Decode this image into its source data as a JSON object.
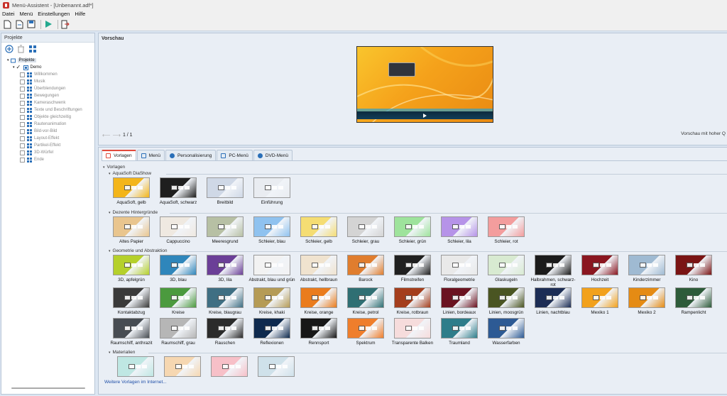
{
  "window": {
    "title": "Menü-Assistent - [Unbenannt.adf*]"
  },
  "menu": [
    "Datei",
    "Menü",
    "Einstellungen",
    "Hilfe"
  ],
  "toolbar": {
    "icons": [
      "new-document-icon",
      "open-icon",
      "save-icon",
      "play-icon",
      "exit-icon"
    ]
  },
  "projects": {
    "header": "Projekte",
    "root_label": "Projekte",
    "project_label": "Demo",
    "items": [
      "Willkommen",
      "Musik",
      "Überblendungen",
      "Bewegungen",
      "Kameraschwenk",
      "Texte und Beschriftungen",
      "Objekte gleichzeitig",
      "Rautenanimation",
      "Bild-vor-Bild",
      "Layout-Effekt",
      "Partikel-Effekt",
      "3D-Würfel",
      "Ende"
    ]
  },
  "preview": {
    "label": "Vorschau",
    "page": "1 / 1",
    "hq_label": "Vorschau mit hoher Q"
  },
  "tabs": [
    "Vorlagen",
    "Menü",
    "Personalisierung",
    "PC-Menü",
    "DVD-Menü"
  ],
  "gallery": {
    "root": "Vorlagen",
    "groups": [
      {
        "name": "AquaSoft DiaShow",
        "items": [
          {
            "label": "AquaSoft, gelb",
            "color": "#f3b51a",
            "dark": false
          },
          {
            "label": "AquaSoft, schwarz",
            "color": "#1e1e1e",
            "dark": true
          },
          {
            "label": "Breitbild",
            "color": "#cfd8e6",
            "dark": false
          },
          {
            "label": "Einführung",
            "color": "#e9ecf1",
            "dark": false
          }
        ]
      },
      {
        "name": "Dezente Hintergründe",
        "items": [
          {
            "label": "Altes Papier",
            "color": "#e9c58e"
          },
          {
            "label": "Cappuccino",
            "color": "#efe9e1"
          },
          {
            "label": "Meeresgrund",
            "color": "#b7c0a4"
          },
          {
            "label": "Schleier, blau",
            "color": "#8fc2ef"
          },
          {
            "label": "Schleier, gelb",
            "color": "#f5dd73"
          },
          {
            "label": "Schleier, grau",
            "color": "#d4d4d4"
          },
          {
            "label": "Schleier, grün",
            "color": "#9ee39c"
          },
          {
            "label": "Schleier, lila",
            "color": "#b693e8"
          },
          {
            "label": "Schleier, rot",
            "color": "#f39d9d"
          }
        ]
      },
      {
        "name": "Geometrie und Abstraktion",
        "rows": [
          [
            {
              "label": "3D, apfelgrün",
              "color": "#b5d02b"
            },
            {
              "label": "3D, blau",
              "color": "#2f86bb"
            },
            {
              "label": "3D, lila",
              "color": "#6b3f97"
            },
            {
              "label": "Abstrakt, blau und grün",
              "color": "#f2f2f2"
            },
            {
              "label": "Abstrakt, hellbraun",
              "color": "#f0e3cf"
            },
            {
              "label": "Barock",
              "color": "#e07d2e"
            },
            {
              "label": "Filmstreifen",
              "color": "#202020"
            },
            {
              "label": "Floralgeometrie",
              "color": "#e9e9e9"
            },
            {
              "label": "Glaskugeln",
              "color": "#d8ead1"
            },
            {
              "label": "Halbrahmen, schwarz-rot",
              "color": "#1b1b1b"
            },
            {
              "label": "Hochzeit",
              "color": "#8a1620"
            },
            {
              "label": "Kinderzimmer",
              "color": "#9fbad2"
            },
            {
              "label": "Kino",
              "color": "#7a1414"
            }
          ],
          [
            {
              "label": "Kontaktabzug",
              "color": "#3a3a3a"
            },
            {
              "label": "Kreise",
              "color": "#4b9a3e"
            },
            {
              "label": "Kreise, blaugrau",
              "color": "#3f6f83"
            },
            {
              "label": "Kreise, khaki",
              "color": "#b59b56"
            },
            {
              "label": "Kreise, orange",
              "color": "#ea7c1d"
            },
            {
              "label": "Kreise, petrol",
              "color": "#2f6f73"
            },
            {
              "label": "Kreise, rotbraun",
              "color": "#a43e1d"
            },
            {
              "label": "Linien, bordeaux",
              "color": "#6a1220"
            },
            {
              "label": "Linien, moosgrün",
              "color": "#4a5522"
            },
            {
              "label": "Linien, nachtblau",
              "color": "#1c2d55"
            },
            {
              "label": "Mexiko 1",
              "color": "#f2a11c"
            },
            {
              "label": "Mexiko 2",
              "color": "#e58b14"
            },
            {
              "label": "Rampenlicht",
              "color": "#2d5b3a"
            }
          ],
          [
            {
              "label": "Raumschiff, anthrazit",
              "color": "#474c52"
            },
            {
              "label": "Raumschiff, grau",
              "color": "#b6b6b6"
            },
            {
              "label": "Rauschen",
              "color": "#2b2b2b"
            },
            {
              "label": "Reflexionen",
              "color": "#0f2a4e"
            },
            {
              "label": "Rennsport",
              "color": "#171717"
            },
            {
              "label": "Spektrum",
              "color": "#ef7e2c"
            },
            {
              "label": "Transparente Balken",
              "color": "#f6dcdc"
            },
            {
              "label": "Traumland",
              "color": "#2e7d8a"
            },
            {
              "label": "Wasserfarben",
              "color": "#2d5a94"
            }
          ]
        ]
      },
      {
        "name": "Materialien",
        "items": [
          {
            "label": "",
            "color": "#bfe7e3"
          },
          {
            "label": "",
            "color": "#f6d7b1"
          },
          {
            "label": "",
            "color": "#f7c0c8"
          },
          {
            "label": "",
            "color": "#cfe1ea"
          }
        ]
      }
    ],
    "more_link": "Weitere Vorlagen im Internet..."
  }
}
